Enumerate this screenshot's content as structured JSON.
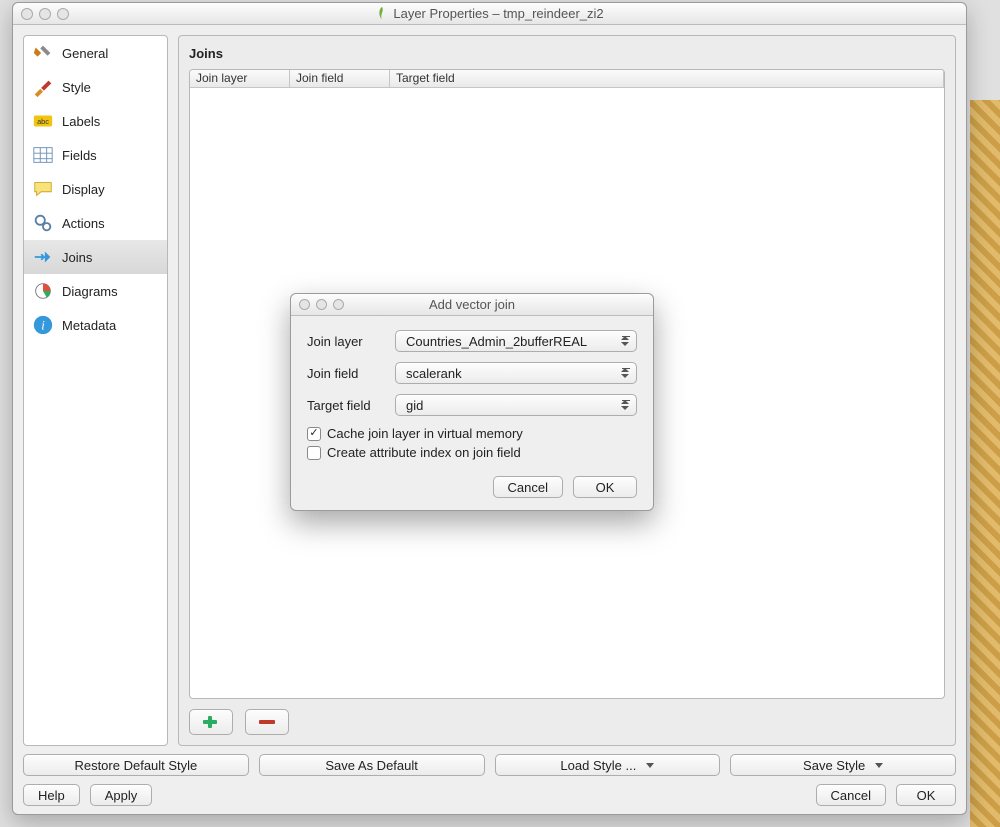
{
  "window": {
    "title": "Layer Properties – tmp_reindeer_zi2"
  },
  "sidebar": {
    "items": [
      {
        "label": "General"
      },
      {
        "label": "Style"
      },
      {
        "label": "Labels"
      },
      {
        "label": "Fields"
      },
      {
        "label": "Display"
      },
      {
        "label": "Actions"
      },
      {
        "label": "Joins"
      },
      {
        "label": "Diagrams"
      },
      {
        "label": "Metadata"
      }
    ],
    "selected_index": 6
  },
  "joins_panel": {
    "heading": "Joins",
    "columns": [
      "Join layer",
      "Join field",
      "Target field"
    ]
  },
  "style_row": {
    "restore": "Restore Default Style",
    "save_default": "Save As Default",
    "load": "Load Style ...",
    "save": "Save Style"
  },
  "footer": {
    "help": "Help",
    "apply": "Apply",
    "cancel": "Cancel",
    "ok": "OK"
  },
  "dialog": {
    "title": "Add vector join",
    "fields": {
      "join_layer_label": "Join layer",
      "join_layer_value": "Countries_Admin_2bufferREAL",
      "join_field_label": "Join field",
      "join_field_value": "scalerank",
      "target_field_label": "Target field",
      "target_field_value": "gid"
    },
    "cache_label": "Cache join layer in virtual memory",
    "cache_checked": true,
    "index_label": "Create attribute index on join field",
    "index_checked": false,
    "cancel": "Cancel",
    "ok": "OK"
  }
}
